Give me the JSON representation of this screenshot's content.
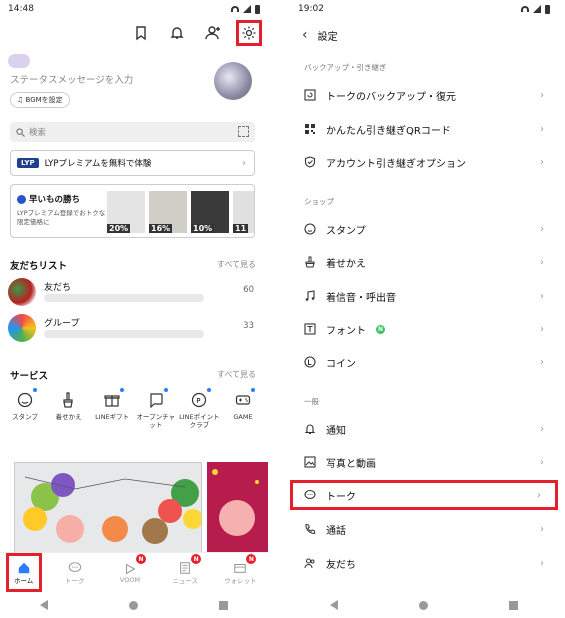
{
  "left": {
    "time": "14:48",
    "status_message": "ステータスメッセージを入力",
    "bgm_label": "BGMを設定",
    "search_placeholder": "検索",
    "lyp_logo": "LYP",
    "lyp_text": "LYPプレミアムを無料で体験",
    "promo": {
      "title": "早いもの勝ち",
      "subtitle": "LYPプレミアム登録でおトクな限定価格に",
      "products": [
        "20%",
        "16%",
        "10%",
        "11"
      ]
    },
    "friends_title": "友だちリスト",
    "friends_see_all": "すべて見る",
    "friends": [
      {
        "label": "友だち",
        "count": "60"
      },
      {
        "label": "グループ",
        "count": "33"
      }
    ],
    "services_title": "サービス",
    "services_see_all": "すべて見る",
    "services": [
      {
        "label": "スタンプ",
        "icon": "smile-icon"
      },
      {
        "label": "着せかえ",
        "icon": "brush-icon"
      },
      {
        "label": "LINEギフト",
        "icon": "gift-icon"
      },
      {
        "label": "オープンチャット",
        "icon": "chat-bubble-icon"
      },
      {
        "label": "LINEポイントクラブ",
        "icon": "points-icon"
      },
      {
        "label": "GAME",
        "icon": "game-icon"
      }
    ],
    "tabs": [
      {
        "label": "ホーム",
        "icon": "home-icon",
        "badge": ""
      },
      {
        "label": "トーク",
        "icon": "talk-icon",
        "badge": ""
      },
      {
        "label": "VOOM",
        "icon": "voom-icon",
        "badge": "N"
      },
      {
        "label": "ニュース",
        "icon": "news-icon",
        "badge": "N"
      },
      {
        "label": "ウォレット",
        "icon": "wallet-icon",
        "badge": "N"
      }
    ]
  },
  "right": {
    "time": "19:02",
    "header_title": "設定",
    "sections": [
      {
        "title": "バックアップ・引き継ぎ",
        "items": [
          {
            "label": "トークのバックアップ・復元",
            "icon": "backup-icon"
          },
          {
            "label": "かんたん引き継ぎQRコード",
            "icon": "qr-icon"
          },
          {
            "label": "アカウント引き継ぎオプション",
            "icon": "shield-icon"
          }
        ]
      },
      {
        "title": "ショップ",
        "items": [
          {
            "label": "スタンプ",
            "icon": "smile-icon"
          },
          {
            "label": "着せかえ",
            "icon": "brush-icon"
          },
          {
            "label": "着信音・呼出音",
            "icon": "music-icon"
          },
          {
            "label": "フォント",
            "icon": "font-icon",
            "badge": "N"
          },
          {
            "label": "コイン",
            "icon": "coin-icon"
          }
        ]
      },
      {
        "title": "一般",
        "items": [
          {
            "label": "通知",
            "icon": "bell-icon"
          },
          {
            "label": "写真と動画",
            "icon": "photo-icon"
          },
          {
            "label": "トーク",
            "icon": "talk-icon"
          },
          {
            "label": "通話",
            "icon": "phone-icon"
          },
          {
            "label": "友だち",
            "icon": "friends-icon"
          }
        ]
      }
    ]
  },
  "colors": {
    "highlight": "#e5202e",
    "line_green": "#06c755"
  }
}
